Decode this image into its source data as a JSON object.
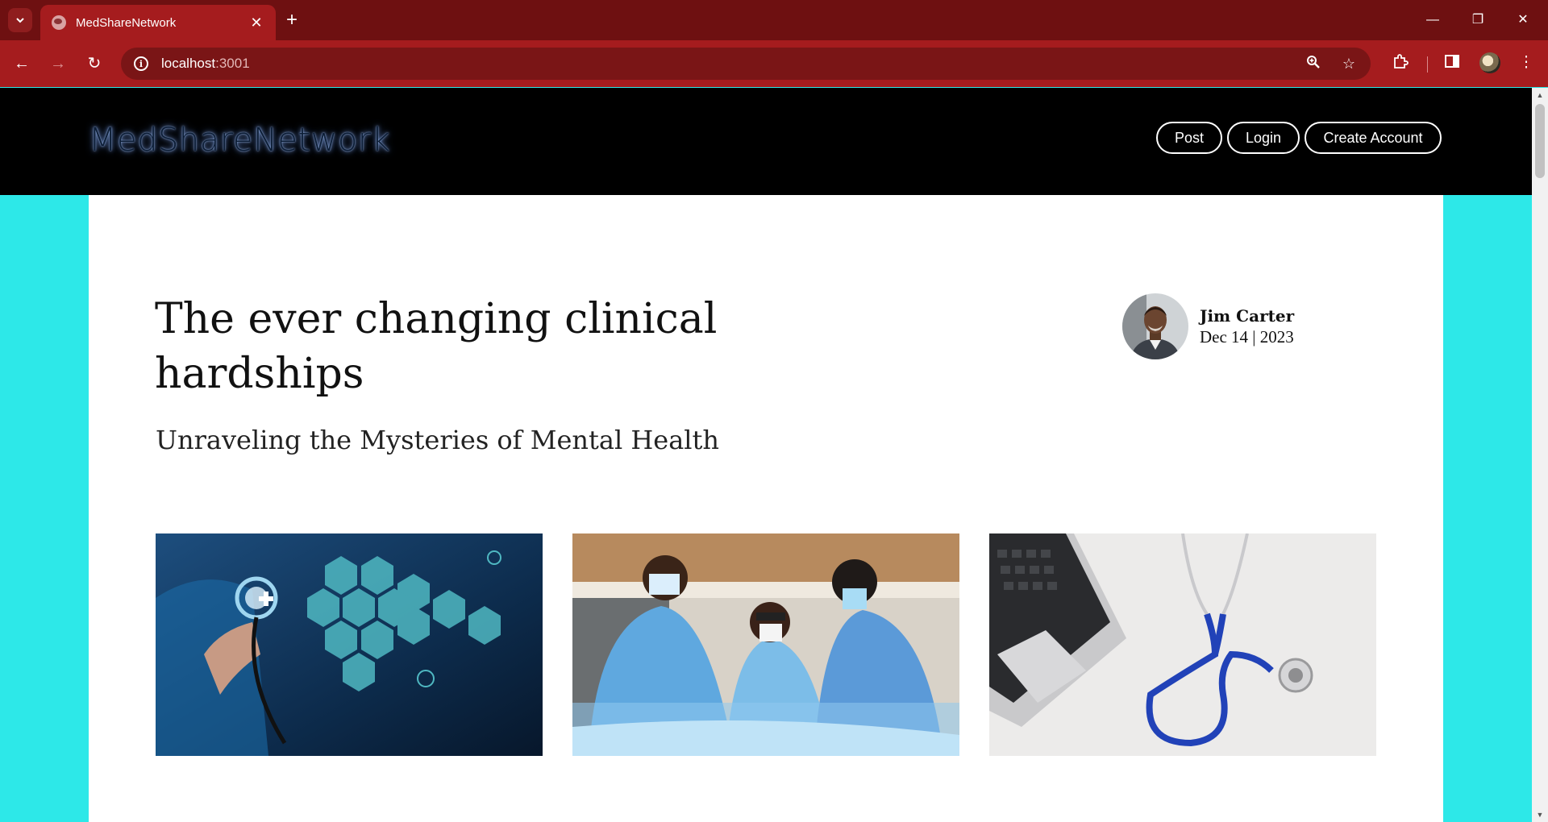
{
  "browser": {
    "tab_title": "MedShareNetwork",
    "url_host": "localhost",
    "url_port": ":3001"
  },
  "site": {
    "brand": "MedShareNetwork",
    "nav": {
      "post": "Post",
      "login": "Login",
      "create_account": "Create Account"
    }
  },
  "post": {
    "title": "The ever changing clinical hardships",
    "subtitle": "Unraveling the Mysteries of Mental Health",
    "author": {
      "name": "Jim Carter",
      "date": "Dec 14 | 2023"
    }
  },
  "colors": {
    "page_background": "#2de8e8",
    "chrome_dark": "#6e1011",
    "chrome_accent": "#a51c1e",
    "header_background": "#000000"
  }
}
